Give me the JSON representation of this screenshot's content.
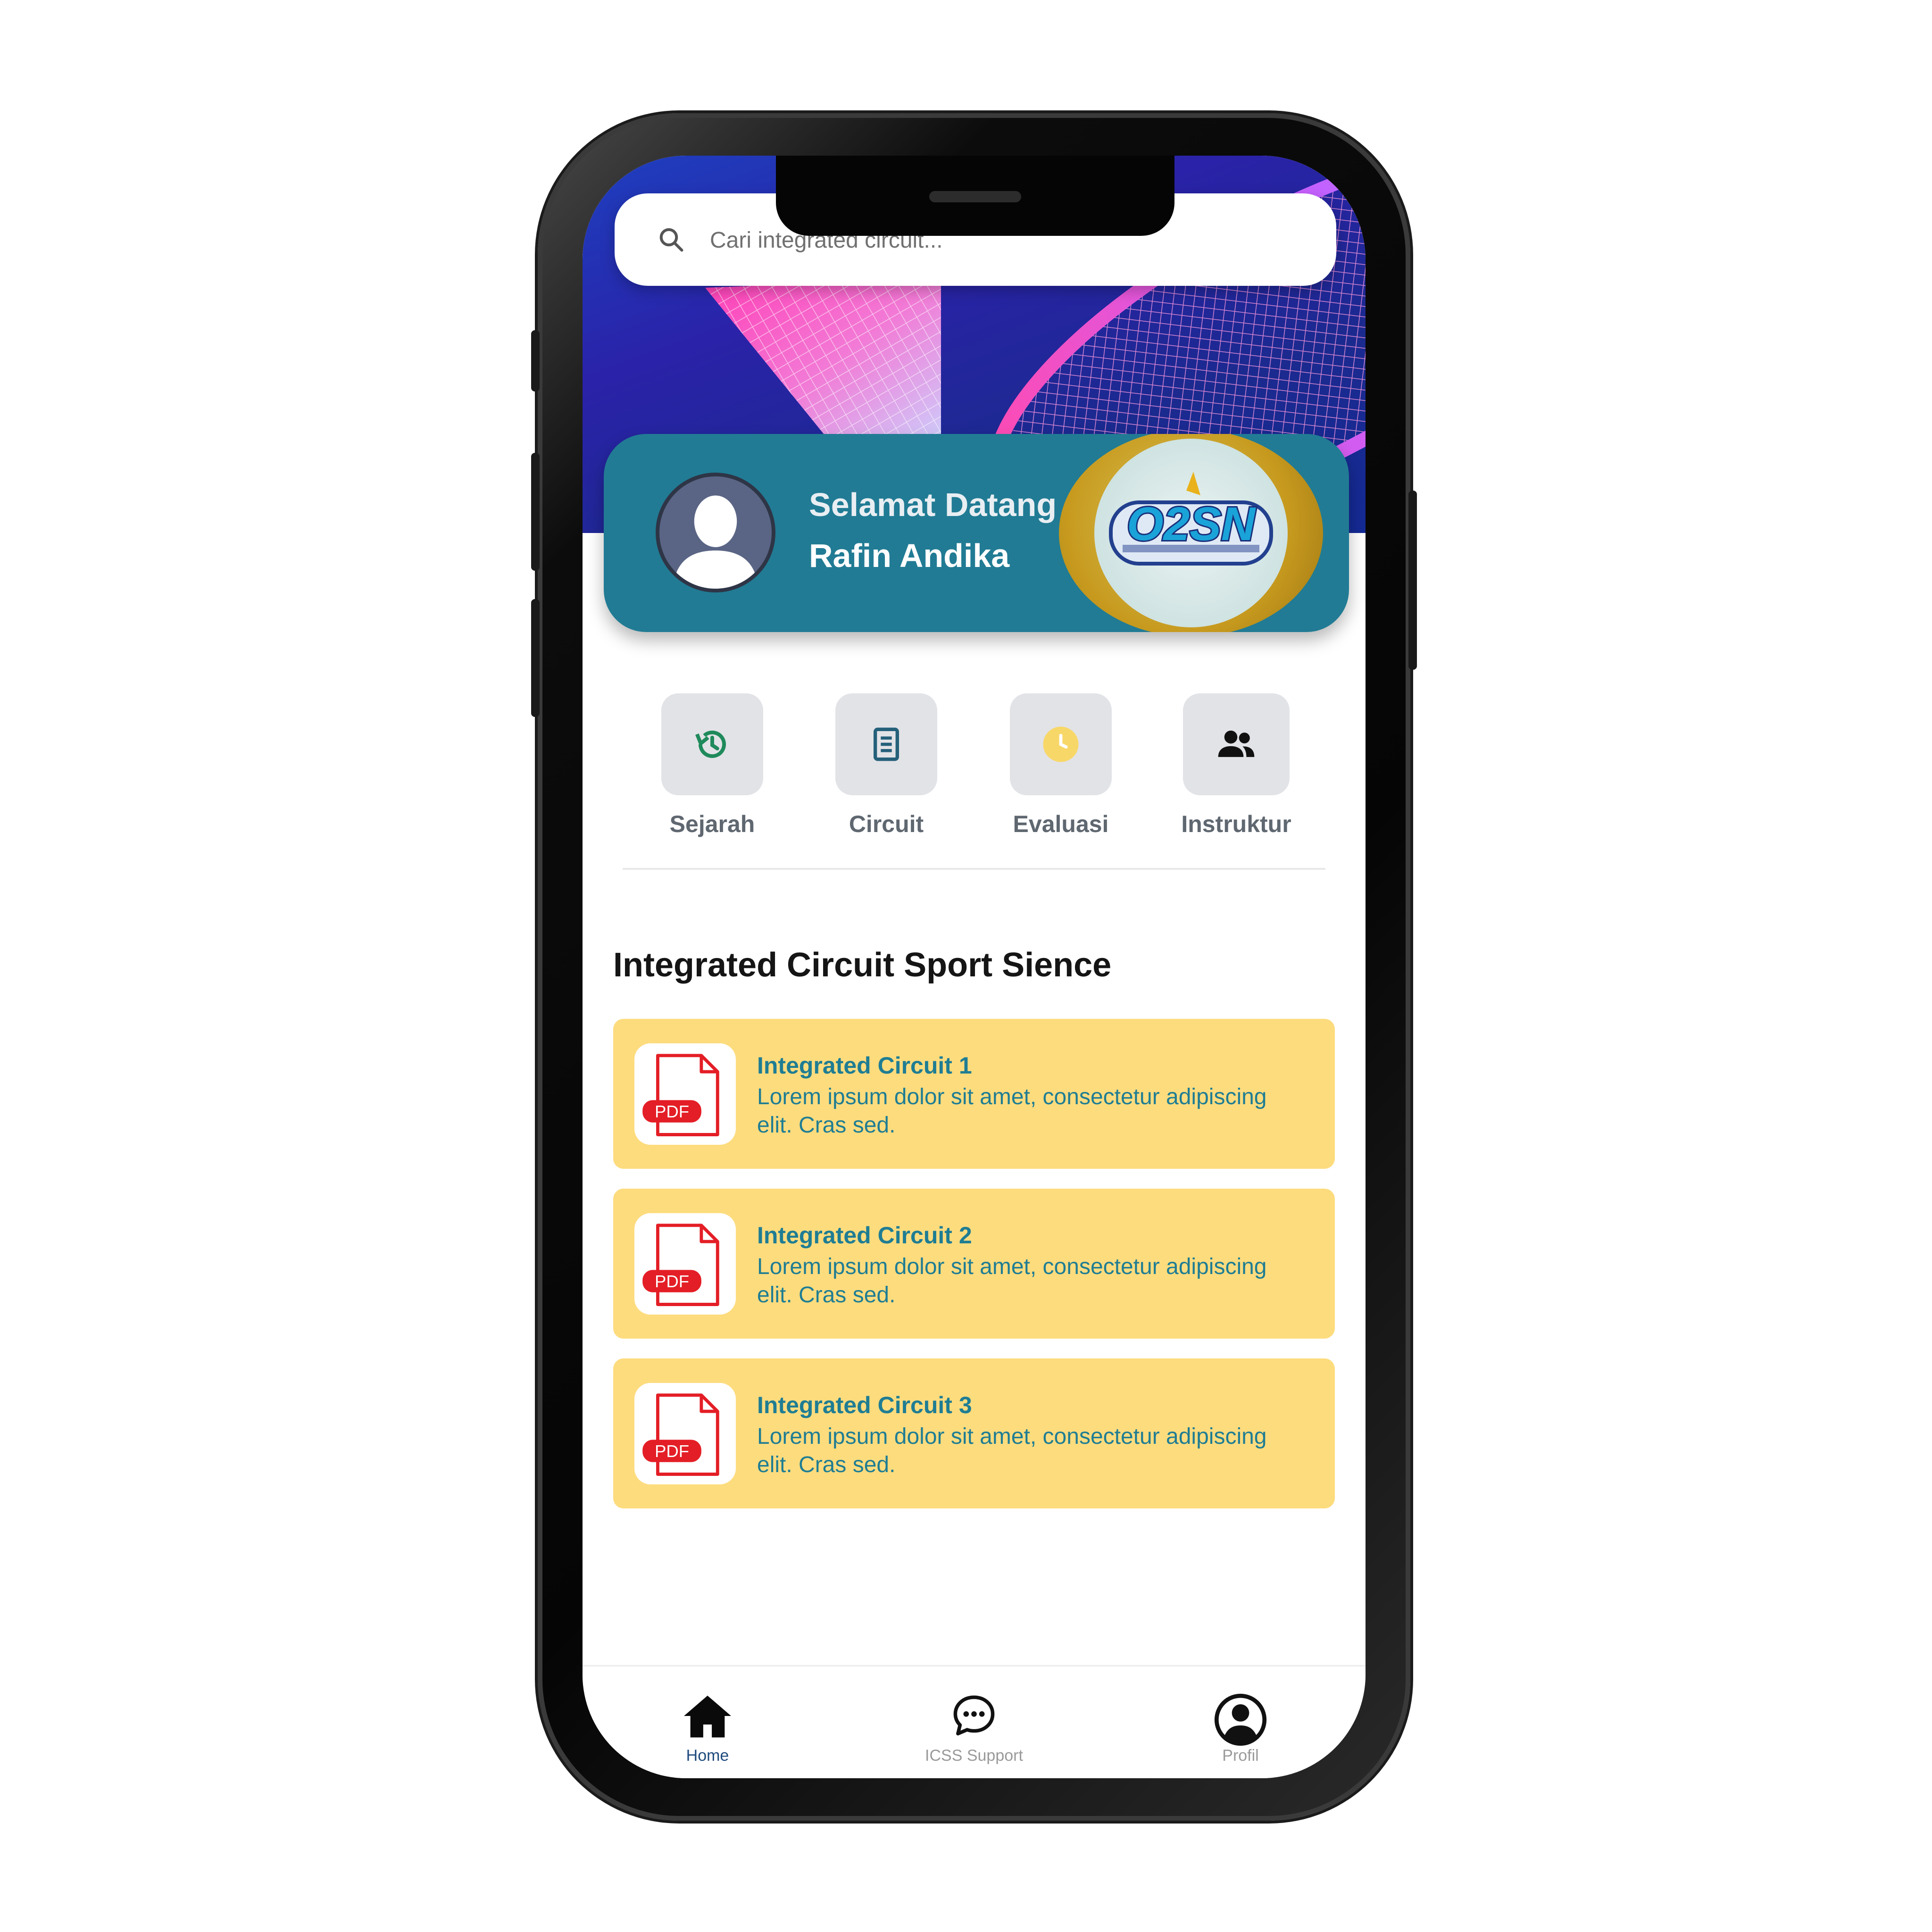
{
  "search": {
    "placeholder": "Cari integrated circuit..."
  },
  "welcome": {
    "greeting": "Selamat Datang",
    "username": "Rafin Andika",
    "logo_text": "O2SN"
  },
  "menu": [
    {
      "label": "Sejarah",
      "icon": "history-icon"
    },
    {
      "label": "Circuit",
      "icon": "document-icon"
    },
    {
      "label": "Evaluasi",
      "icon": "clock-icon"
    },
    {
      "label": "Instruktur",
      "icon": "people-icon"
    }
  ],
  "section": {
    "title": "Integrated Circuit Sport Sience"
  },
  "documents": [
    {
      "title": "Integrated Circuit 1",
      "description": "Lorem ipsum dolor sit amet, consectetur adipiscing elit. Cras sed.",
      "badge": "PDF"
    },
    {
      "title": "Integrated Circuit 2",
      "description": "Lorem ipsum dolor sit amet, consectetur adipiscing elit. Cras sed.",
      "badge": "PDF"
    },
    {
      "title": "Integrated Circuit 3",
      "description": "Lorem ipsum dolor sit amet, consectetur adipiscing elit. Cras sed.",
      "badge": "PDF"
    }
  ],
  "nav": [
    {
      "label": "Home",
      "icon": "home-icon",
      "active": true
    },
    {
      "label": "ICSS Support",
      "icon": "chat-icon",
      "active": false
    },
    {
      "label": "Profil",
      "icon": "profile-icon",
      "active": false
    }
  ],
  "colors": {
    "card_teal": "#217b94",
    "card_yellow": "#fddc7e",
    "pdf_red": "#e41e26",
    "text_teal": "#1f7d93"
  }
}
